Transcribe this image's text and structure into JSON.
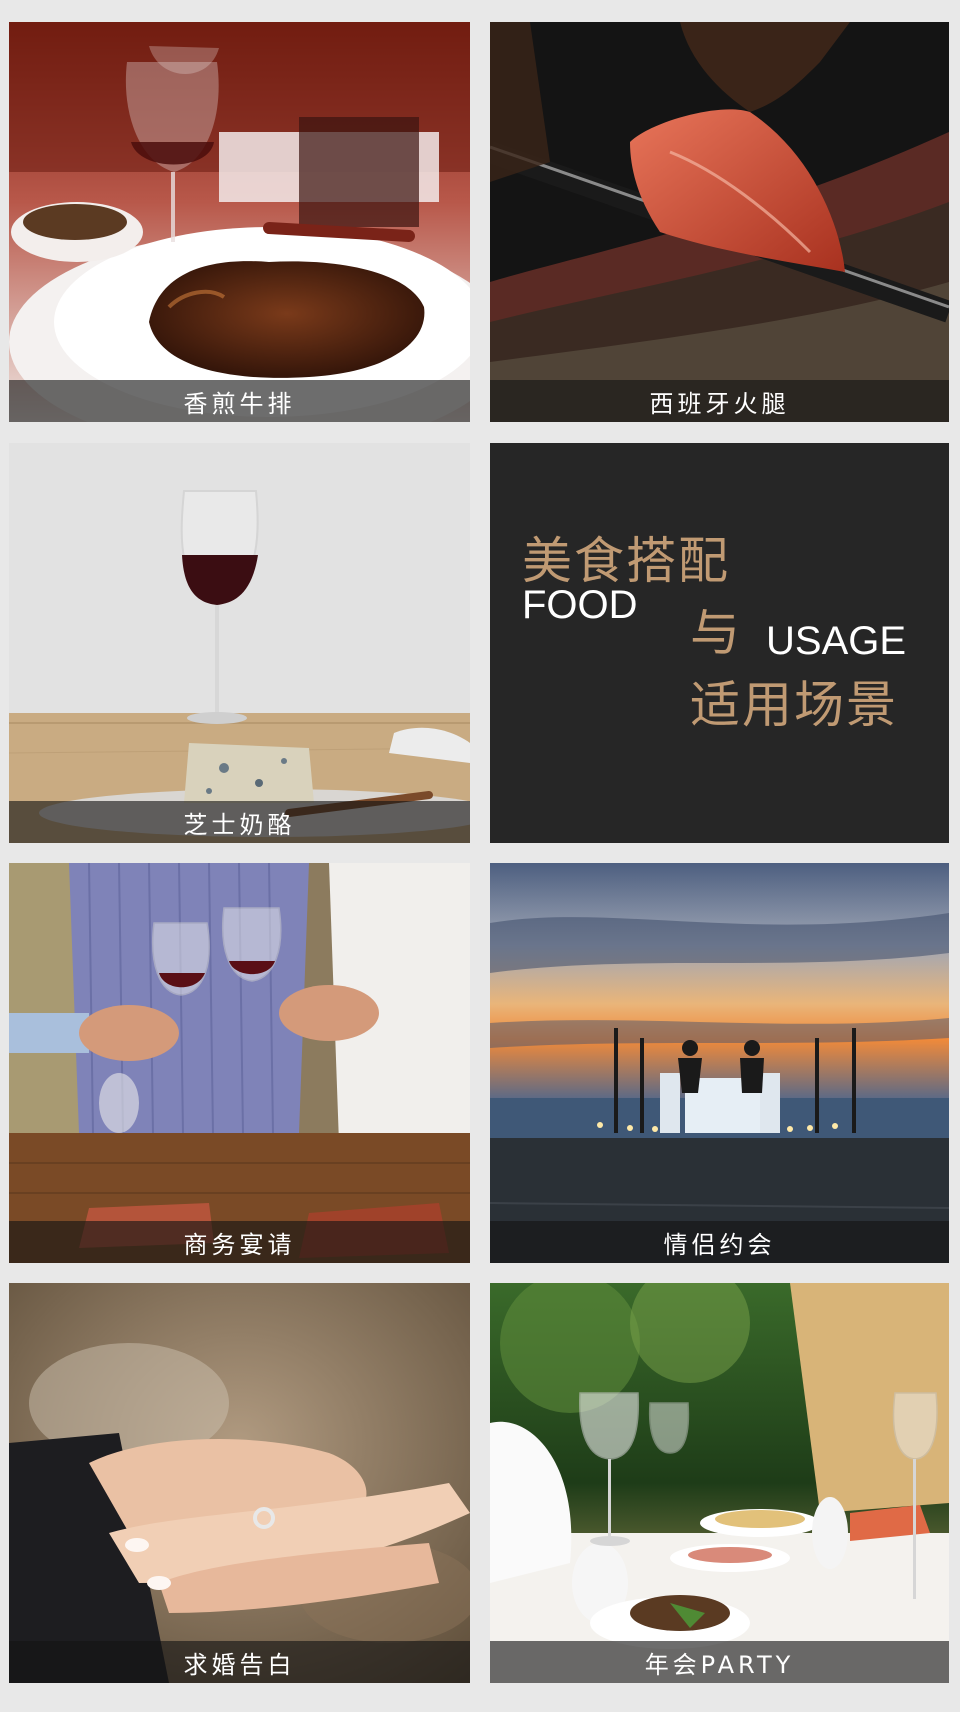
{
  "tiles": [
    {
      "caption": "香煎牛排"
    },
    {
      "caption": "西班牙火腿"
    },
    {
      "caption": "芝士奶酪"
    },
    {
      "caption": "商务宴请"
    },
    {
      "caption": "情侣约会"
    },
    {
      "caption": "求婚告白"
    },
    {
      "caption": "年会PARTY"
    }
  ],
  "title_panel": {
    "line1_cn": "美食搭配",
    "line1_en": "FOOD",
    "connector": "与",
    "line2_en": "USAGE",
    "line2_cn": "适用场景"
  },
  "colors": {
    "accent_gold": "#c09a73",
    "panel_bg": "#262626",
    "page_bg": "#e8e8e8"
  }
}
